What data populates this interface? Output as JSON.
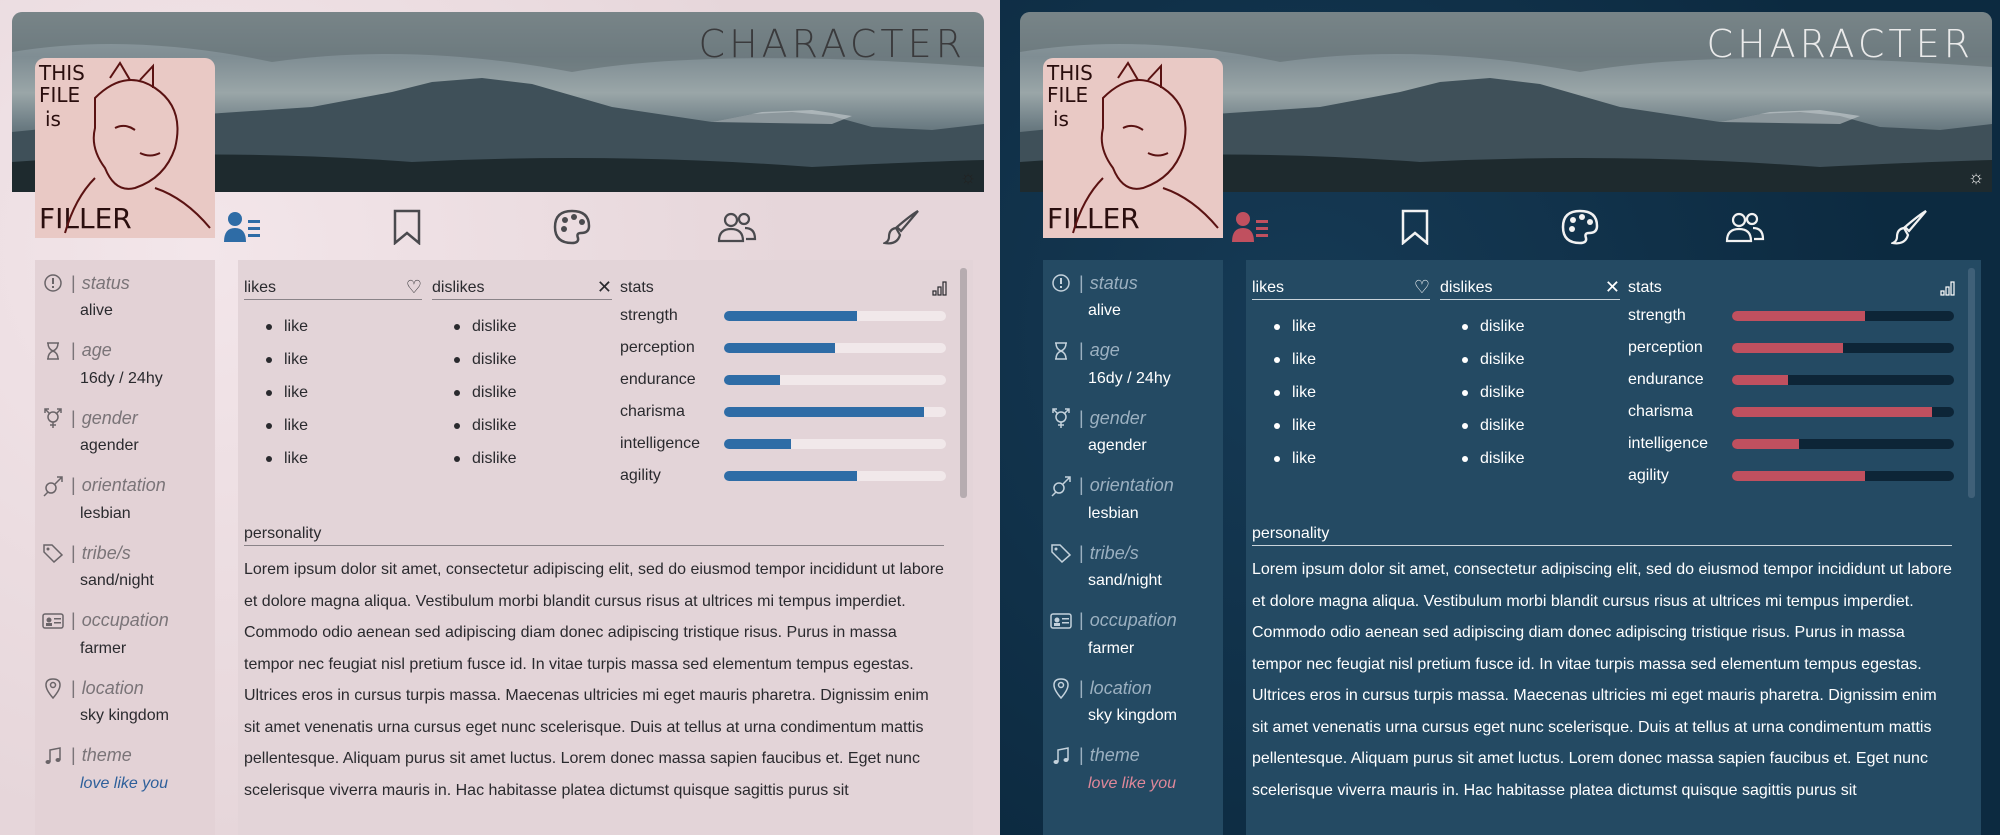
{
  "header": {
    "title": "CHARACTER",
    "theme_toggle_icon": "sun-icon"
  },
  "avatar": {
    "caption": "THIS FILE is FILLER"
  },
  "tabs": [
    {
      "name": "profile",
      "icon": "id-card-icon"
    },
    {
      "name": "bookmarks",
      "icon": "bookmark-icon"
    },
    {
      "name": "palette",
      "icon": "palette-icon"
    },
    {
      "name": "relationships",
      "icon": "people-icon"
    },
    {
      "name": "art",
      "icon": "brush-icon"
    }
  ],
  "sidebar": {
    "items": [
      {
        "label": "status",
        "value": "alive",
        "icon": "alert-icon"
      },
      {
        "label": "age",
        "value": "16dy / 24hy",
        "icon": "hourglass-icon"
      },
      {
        "label": "gender",
        "value": "agender",
        "icon": "gender-icon"
      },
      {
        "label": "orientation",
        "value": "lesbian",
        "icon": "orientation-icon"
      },
      {
        "label": "tribe/s",
        "value": "sand/night",
        "icon": "tag-icon"
      },
      {
        "label": "occupation",
        "value": "farmer",
        "icon": "id-badge-icon"
      },
      {
        "label": "location",
        "value": "sky kingdom",
        "icon": "location-pin-icon"
      },
      {
        "label": "theme",
        "value": "love like you",
        "icon": "music-note-icon"
      }
    ]
  },
  "likes": {
    "title": "likes",
    "items": [
      "like",
      "like",
      "like",
      "like",
      "like"
    ]
  },
  "dislikes": {
    "title": "dislikes",
    "items": [
      "dislike",
      "dislike",
      "dislike",
      "dislike",
      "dislike"
    ]
  },
  "stats": {
    "title": "stats",
    "items": [
      {
        "label": "strength",
        "value": 0.6
      },
      {
        "label": "perception",
        "value": 0.5
      },
      {
        "label": "endurance",
        "value": 0.25
      },
      {
        "label": "charisma",
        "value": 0.9
      },
      {
        "label": "intelligence",
        "value": 0.3
      },
      {
        "label": "agility",
        "value": 0.6
      }
    ]
  },
  "personality": {
    "title": "personality",
    "text": "Lorem ipsum dolor sit amet, consectetur adipiscing elit, sed do eiusmod tempor incididunt ut labore et dolore magna aliqua. Vestibulum morbi blandit cursus risus at ultrices mi tempus imperdiet. Commodo odio aenean sed adipiscing diam donec adipiscing tristique risus. Purus in massa tempor nec feugiat nisl pretium fusce id. In vitae turpis massa sed elementum tempus egestas. Ultrices eros in cursus turpis massa. Maecenas ultricies mi eget mauris pharetra. Dignissim enim sit amet venenatis urna cursus eget nunc scelerisque. Duis at tellus at urna condimentum mattis pellentesque. Aliquam purus sit amet luctus. Lorem donec massa sapien faucibus et. Eget nunc scelerisque viverra mauris in. Hac habitasse platea dictumst quisque sagittis purus sit"
  },
  "colors": {
    "light_accent": "#2e6ca6",
    "dark_accent": "#c0505f",
    "light_bg": "#ecdfe2",
    "dark_bg": "#0f3048"
  }
}
